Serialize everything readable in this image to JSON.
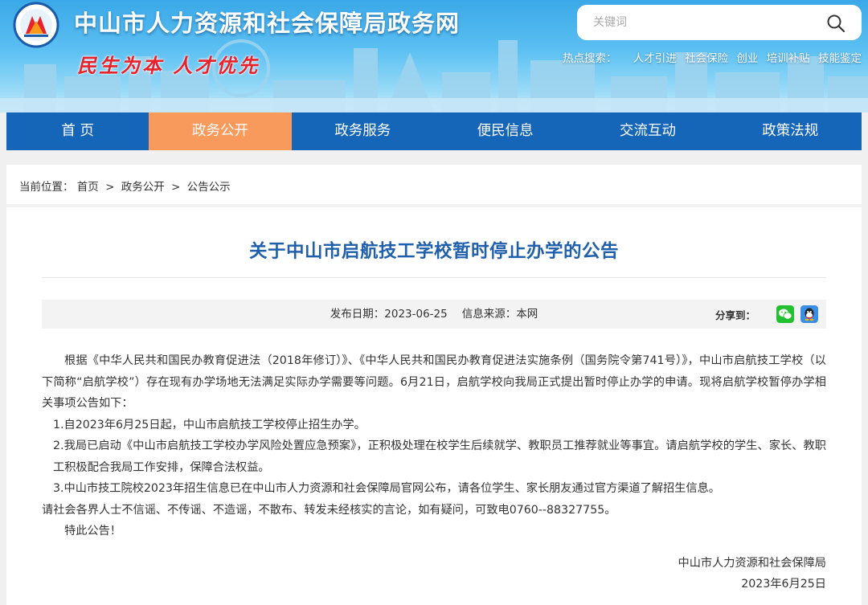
{
  "header": {
    "site_title": "中山市人力资源和社会保障局政务网",
    "slogan": "民生为本  人才优先",
    "search": {
      "placeholder": "关键词"
    },
    "hot_search": {
      "label": "热点搜索：",
      "links": [
        "人才引进",
        "社会保险",
        "创业",
        "培训补贴",
        "技能鉴定"
      ]
    },
    "icons": {
      "logo": "bureau-logo",
      "search": "search-icon"
    },
    "colors": {
      "banner_sky": "#3aa8e8",
      "slogan": "#e8212a"
    }
  },
  "nav": {
    "items": [
      "首  页",
      "政务公开",
      "政务服务",
      "便民信息",
      "交流互动",
      "政策法规"
    ],
    "active_index": 1,
    "colors": {
      "bar": "#1565b8",
      "active": "#f79a5c"
    }
  },
  "breadcrumb": {
    "prefix": "当前位置：",
    "items": [
      "首页",
      "政务公开",
      "公告公示"
    ],
    "separator": ">"
  },
  "article": {
    "title": "关于中山市启航技工学校暂时停止办学的公告",
    "title_color": "#1f5fab",
    "publish_date_label": "发布日期：",
    "publish_date": "2023-06-25",
    "source_label": "信息来源：",
    "source": "本网",
    "share_label": "分享到：",
    "share_icons": [
      "wechat-icon",
      "qq-icon"
    ],
    "paragraphs": [
      "根据《中华人民共和国民办教育促进法（2018年修订）》、《中华人民共和国民办教育促进法实施条例（国务院令第741号）》，中山市启航技工学校（以下简称“启航学校”）存在现有办学场地无法满足实际办学需要等问题。6月21日，启航学校向我局正式提出暂时停止办学的申请。现将启航学校暂停办学相关事项公告如下：",
      "1.自2023年6月25日起，中山市启航技工学校停止招生办学。",
      "2.我局已启动《中山市启航技工学校办学风险处置应急预案》，正积极处理在校学生后续就学、教职员工推荐就业等事宜。请启航学校的学生、家长、教职工积极配合我局工作安排，保障合法权益。",
      "3.中山市技工院校2023年招生信息已在中山市人力资源和社会保障局官网公布，请各位学生、家长朋友通过官方渠道了解招生信息。",
      "请社会各界人士不信谣、不传谣、不造谣，不散布、转发未经核实的言论，如有疑问，可致电0760--88327755。",
      "特此公告！"
    ],
    "signature": {
      "organization": "中山市人力资源和社会保障局",
      "date": "2023年6月25日"
    }
  }
}
